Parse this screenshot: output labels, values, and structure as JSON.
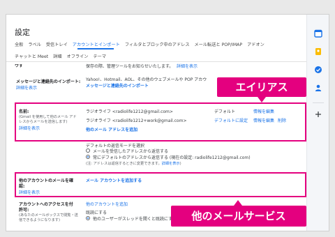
{
  "page": {
    "title": "設定"
  },
  "tabs_row1": [
    "全般",
    "ラベル",
    "受信トレイ",
    "アカウントとインポート",
    "フィルタとブロック中のアドレス",
    "メール転送と POP/IMAP",
    "アドオン"
  ],
  "tabs_row2": [
    "チャットと Meet",
    "詳細",
    "オフライン",
    "テーマ"
  ],
  "section_top": {
    "cut_label": "ウす",
    "cut_text": "保存の際、管理ツールをお知らせいたします。",
    "cut_link": "詳細を表示"
  },
  "import": {
    "label": "メッセージと連絡先のインポート:",
    "detail_link": "詳細を表示",
    "desc": "Yahoo!、Hotmail、AOL、その他のウェブメールや POP アカウ",
    "action": "メッセージと連絡先のインポート"
  },
  "name_section": {
    "label": "名前:",
    "note1": "(Gmail を使用して他のメール アド",
    "note2": "レスからメールを送信します)",
    "detail_link": "詳細を表示",
    "accounts": [
      {
        "name": "ラジオライフ <radiolife1212@gmail.com>",
        "status": "デフォルト",
        "edit": "情報を編集",
        "delete": ""
      },
      {
        "name": "ラジオライフ <radiolife1212+work@gmail.com>",
        "status": "デフォルトに設定",
        "edit": "情報を編集",
        "delete": "削除"
      }
    ],
    "add_link": "他のメール アドレスを追加"
  },
  "reply_section": {
    "heading": "デフォルトの返信モードを選択",
    "option1": "メールを受信したアドレスから返信する",
    "option2": "常にデフォルトのアドレスから返信する (現在の設定: radiolife1212@gmail.com)",
    "note": "(注: アドレスは返信するときに変更できます。",
    "note_link": "詳細を表示",
    "note_end": ")"
  },
  "check_mail": {
    "label": "他のアカウントのメールを確",
    "label2": "認:",
    "detail_link": "詳細を表示",
    "action": "メール アカウントを追加する"
  },
  "grant": {
    "label": "アカウントへのアクセスを付",
    "label2": "許可:",
    "note1": "(あなたのメールボックスで閲覧・送",
    "note2": "信できるようになります)",
    "action": "他のアカウントを追加",
    "heading": "既読にする",
    "option": "他のユーザーがスレッドを開くと既読にする"
  },
  "annotations": {
    "alias": "エイリアス",
    "other_mail": "他のメールサービス"
  },
  "colors": {
    "accent": "#1a73e8",
    "highlight": "#e4007f"
  },
  "rail_icons": [
    "calendar-icon",
    "keep-icon",
    "tasks-icon",
    "contacts-icon",
    "add-icon"
  ]
}
